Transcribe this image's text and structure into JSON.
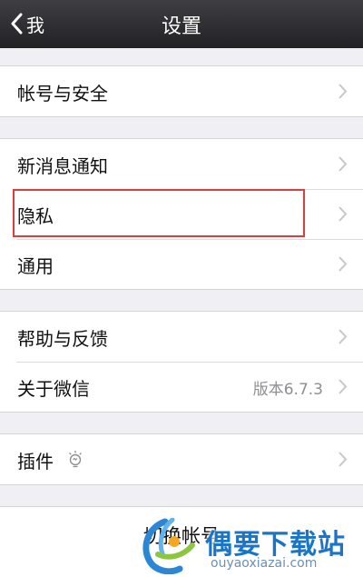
{
  "navbar": {
    "back_label": "我",
    "title": "设置"
  },
  "groups": [
    {
      "items": [
        {
          "label": "帐号与安全"
        }
      ]
    },
    {
      "items": [
        {
          "label": "新消息通知"
        },
        {
          "label": "隐私"
        },
        {
          "label": "通用"
        }
      ]
    },
    {
      "items": [
        {
          "label": "帮助与反馈"
        },
        {
          "label": "关于微信",
          "value": "版本6.7.3"
        }
      ]
    },
    {
      "items": [
        {
          "label": "插件"
        }
      ]
    }
  ],
  "switch_account": {
    "label": "切换帐号"
  },
  "watermark": {
    "text": "偶要下载站",
    "url": "ouyaoxiazai.com"
  },
  "colors": {
    "navbar": "#2e2e31",
    "highlight": "#e03c3c",
    "watermark": "#1a74c7"
  },
  "icons": {
    "back": "chevron-left-icon",
    "disclosure": "chevron-right-icon",
    "plugin": "lightbulb-icon"
  }
}
